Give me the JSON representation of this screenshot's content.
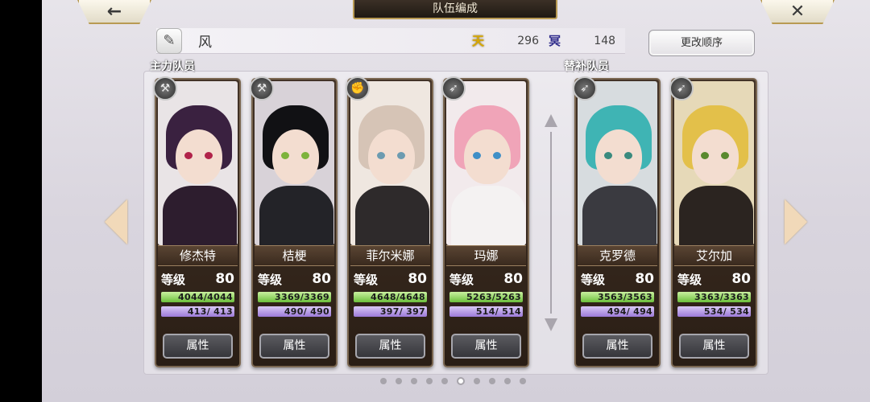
{
  "header": {
    "back_icon": "back-arrow-icon",
    "back_glyph": "←",
    "title": "队伍编成",
    "close_icon": "close-icon",
    "close_glyph": "✕"
  },
  "team": {
    "edit_icon": "pen-icon",
    "name": "风",
    "resources": [
      {
        "icon": "gold-currency-icon",
        "glyph": "天",
        "value": "296"
      },
      {
        "icon": "dark-currency-icon",
        "glyph": "冥",
        "value": "148"
      }
    ],
    "reorder_label": "更改顺序"
  },
  "sections": {
    "main_label": "主力队员",
    "sub_label": "替补队员"
  },
  "members": [
    {
      "name": "修杰特",
      "level_label": "等级",
      "level": "80",
      "hp": "4044/4044",
      "mp": "413/ 413",
      "attr_label": "属性",
      "class_icon": "axe-class-icon",
      "palette": {
        "bg": "#e9e4e6",
        "hair": "#3a2140",
        "eye": "#b1234a",
        "body": "#2d1d2e"
      }
    },
    {
      "name": "桔梗",
      "level_label": "等级",
      "level": "80",
      "hp": "3369/3369",
      "mp": "490/ 490",
      "attr_label": "属性",
      "class_icon": "axe-class-icon",
      "palette": {
        "bg": "#d8d2d8",
        "hair": "#111114",
        "eye": "#7db33c",
        "body": "#232328"
      }
    },
    {
      "name": "菲尔米娜",
      "level_label": "等级",
      "level": "80",
      "hp": "4648/4648",
      "mp": "397/ 397",
      "attr_label": "属性",
      "class_icon": "fist-class-icon",
      "palette": {
        "bg": "#efe7e0",
        "hair": "#d6c4b6",
        "eye": "#6c9bb0",
        "body": "#2e2a2b"
      }
    },
    {
      "name": "玛娜",
      "level_label": "等级",
      "level": "80",
      "hp": "5263/5263",
      "mp": "514/ 514",
      "attr_label": "属性",
      "class_icon": "bow-class-icon",
      "palette": {
        "bg": "#f2eaec",
        "hair": "#f0a4b8",
        "eye": "#3f8fc7",
        "body": "#f4f2f2"
      }
    },
    {
      "name": "克罗德",
      "level_label": "等级",
      "level": "80",
      "hp": "3563/3563",
      "mp": "494/ 494",
      "attr_label": "属性",
      "class_icon": "bow-class-icon",
      "palette": {
        "bg": "#d7dcdf",
        "hair": "#3fb4b4",
        "eye": "#3a8a7e",
        "body": "#3a3a40"
      }
    },
    {
      "name": "艾尔加",
      "level_label": "等级",
      "level": "80",
      "hp": "3363/3363",
      "mp": "534/ 534",
      "attr_label": "属性",
      "class_icon": "spear-class-icon",
      "palette": {
        "bg": "#e6d9b8",
        "hair": "#e3c04a",
        "eye": "#5a8a2e",
        "body": "#2b2420"
      }
    }
  ],
  "pager": {
    "count": 10,
    "active_index": 5
  }
}
